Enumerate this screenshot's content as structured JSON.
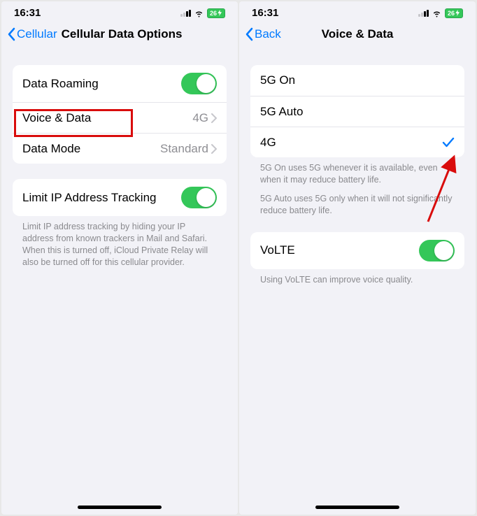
{
  "status": {
    "time": "16:31",
    "battery": "26"
  },
  "left": {
    "back": "Cellular",
    "title": "Cellular Data Options",
    "rows": {
      "roaming": "Data Roaming",
      "voice": "Voice & Data",
      "voice_value": "4G",
      "mode": "Data Mode",
      "mode_value": "Standard",
      "limit": "Limit IP Address Tracking"
    },
    "footer": "Limit IP address tracking by hiding your IP address from known trackers in Mail and Safari. When this is turned off, iCloud Private Relay will also be turned off for this cellular provider."
  },
  "right": {
    "back": "Back",
    "title": "Voice & Data",
    "opts": {
      "on": "5G On",
      "auto": "5G Auto",
      "fourg": "4G"
    },
    "footer1": "5G On uses 5G whenever it is available, even when it may reduce battery life.",
    "footer2": "5G Auto uses 5G only when it will not significantly reduce battery life.",
    "volte": "VoLTE",
    "footer3": "Using VoLTE can improve voice quality."
  }
}
